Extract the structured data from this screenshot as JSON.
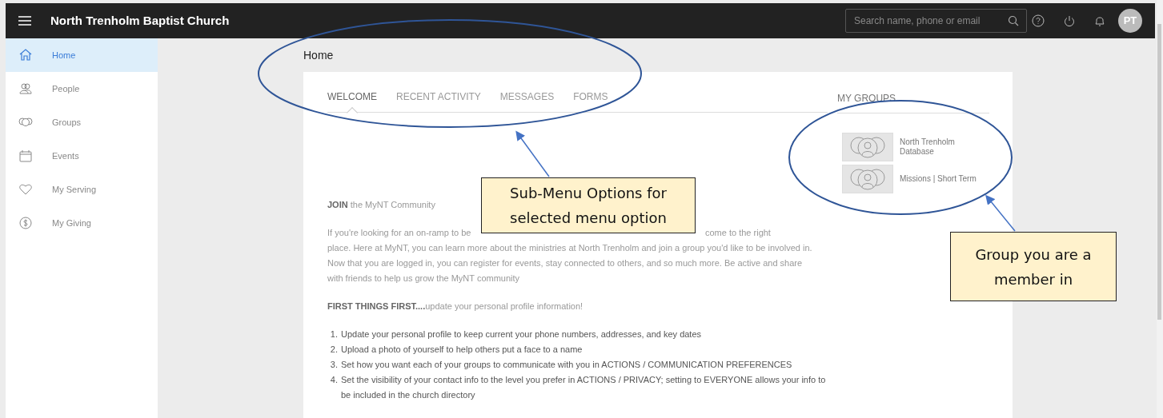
{
  "topbar": {
    "title": "North Trenholm Baptist Church",
    "search": {
      "placeholder": "Search name, phone or email"
    },
    "avatar": "PT"
  },
  "sidebar": {
    "items": [
      {
        "label": "Home",
        "selected": true
      },
      {
        "label": "People",
        "selected": false
      },
      {
        "label": "Groups",
        "selected": false
      },
      {
        "label": "Events",
        "selected": false
      },
      {
        "label": "My Serving",
        "selected": false
      },
      {
        "label": "My Giving",
        "selected": false
      }
    ]
  },
  "page_title": "Home",
  "tabs": [
    {
      "label": "WELCOME",
      "selected": true
    },
    {
      "label": "RECENT ACTIVITY",
      "selected": false
    },
    {
      "label": "MESSAGES",
      "selected": false
    },
    {
      "label": "FORMS",
      "selected": false
    }
  ],
  "welcome": {
    "heading": "**JOIN** the MyNT Community",
    "intro_start": "If you're looking for an on-ramp to be",
    "intro_end": "come to the right",
    "intro_rest": "place. Here at MyNT, you can learn more about the ministries at North Trenholm and join a group you'd like to be involved in. Now that you are logged in, you can register for events, stay connected to others, and so much more. Be active and share with friends to help us grow the MyNT community",
    "first_things": "**FIRST THINGS FIRST....**update your personal profile information!",
    "steps": [
      {
        "number": "1.",
        "text": "Update your personal profile to keep current your phone numbers, addresses, and key dates"
      },
      {
        "number": "2.",
        "text": "Upload a photo of yourself to help others put a face to a name"
      },
      {
        "number": "3.",
        "text": "Set how you want each of your groups to communicate with you in ACTIONS / COMMUNICATION PREFERENCES"
      },
      {
        "number": "4.",
        "text": "Set the visibility of your contact info to the level you prefer in ACTIONS / PRIVACY; setting to EVERYONE allows your info to be included in the church directory"
      }
    ]
  },
  "my_groups": {
    "title": "MY GROUPS",
    "groups": [
      {
        "name": "North Trenholm Database"
      },
      {
        "name": "Missions | Short Term"
      }
    ]
  },
  "annotations": [
    {
      "text": "Sub-Menu Options for selected menu option"
    },
    {
      "text": "Group you are a member in"
    }
  ]
}
